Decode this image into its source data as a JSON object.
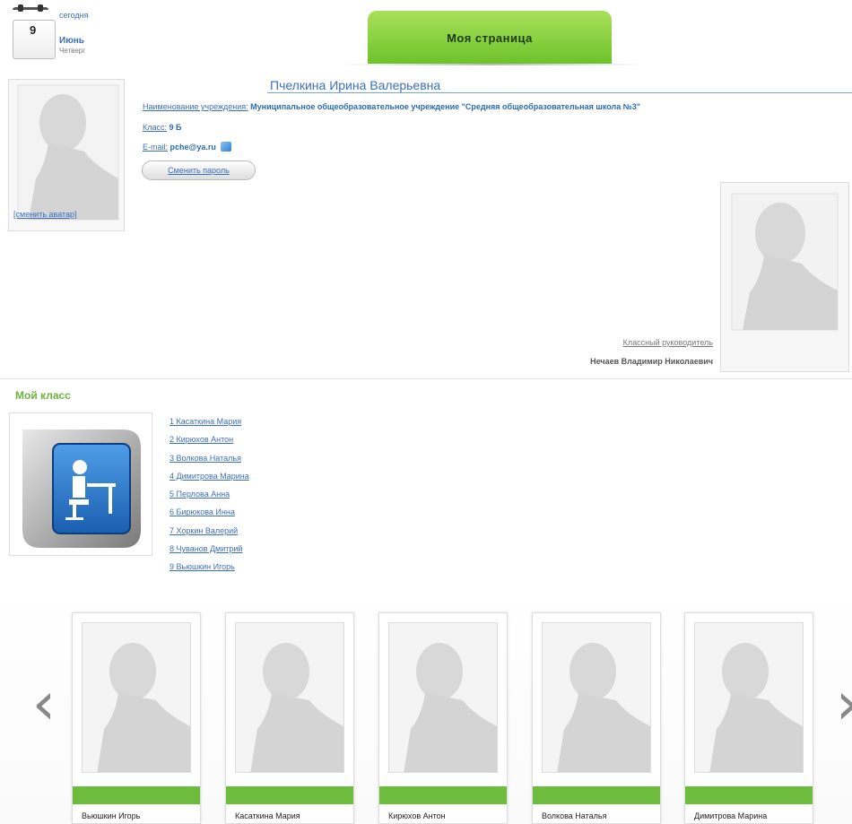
{
  "calendar": {
    "today_label": "сегодня",
    "day": "9",
    "month": "Июнь",
    "weekday": "Четверг"
  },
  "header": {
    "tab_label": "Моя страница"
  },
  "profile": {
    "name": "Пчелкина Ирина Валерьевна",
    "change_avatar": "[сменить аватар]",
    "institution_label": "Наименование учреждения:",
    "institution_value": "Муниципальное общеобразовательное учреждение \"Средняя общеобразовательная школа №3\"",
    "class_label": "Класс:",
    "class_value": "9 Б",
    "email_label": "E-mail:",
    "email_value": "pche@ya.ru",
    "change_password": "Сменить пароль"
  },
  "teacher": {
    "label": "Классный руководитель",
    "name": "Нечаев Владимир Николаевич"
  },
  "my_class": {
    "title": "Мой класс",
    "students": [
      "1 Касаткина Мария",
      "2 Кирюхов Антон",
      "3 Волкова Наталья",
      "4 Димитрова Марина",
      "5 Перлова Анна",
      "6 Бирюкова Инна",
      "7 Хоркин Валерий",
      "8 Чуванов Дмитрий",
      "9 Вьюшкин Игорь"
    ]
  },
  "carousel": {
    "prev_icon": "chevron-left-icon",
    "next_icon": "chevron-right-icon",
    "cards": [
      {
        "name": "Вьюшкин Игорь"
      },
      {
        "name": "Касаткина Мария"
      },
      {
        "name": "Кирюхов Антон"
      },
      {
        "name": "Волкова Наталья"
      },
      {
        "name": "Димитрова Марина"
      }
    ]
  }
}
